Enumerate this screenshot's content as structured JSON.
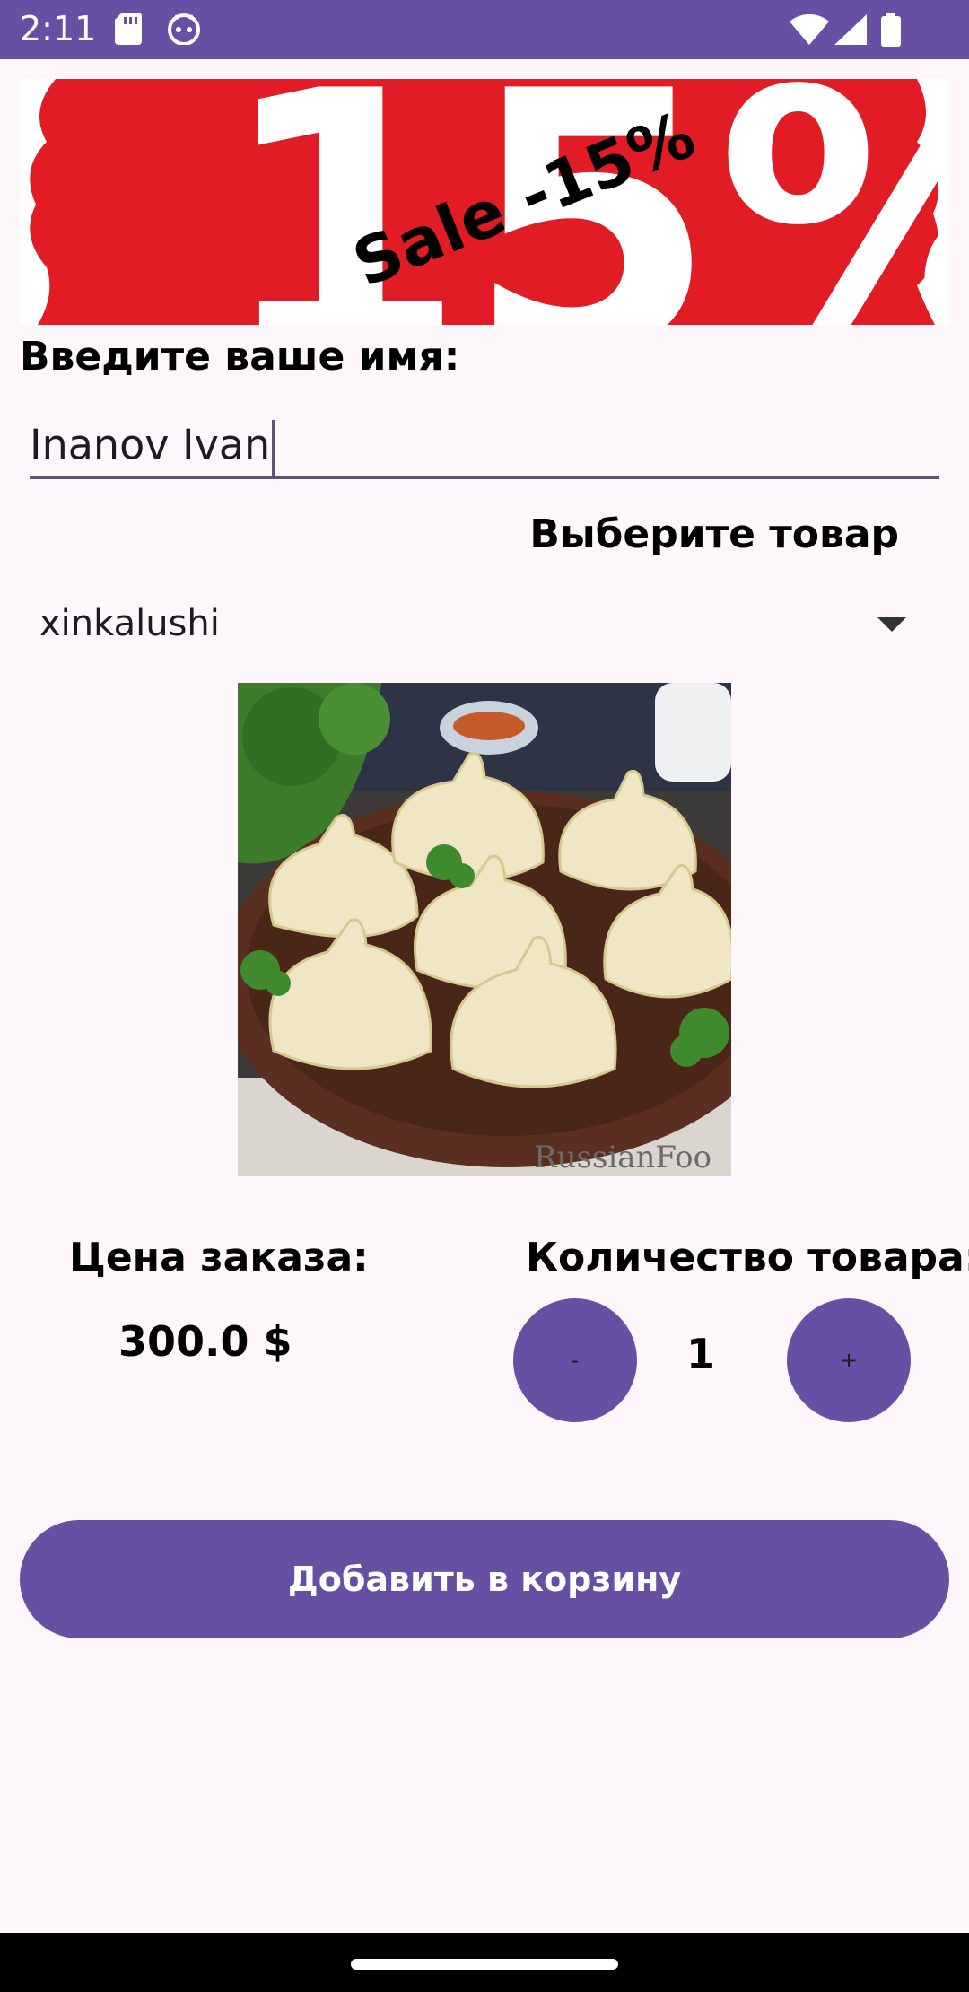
{
  "status_bar": {
    "time": "2:11",
    "icons": [
      "sd-card-icon",
      "cat-face-icon",
      "wifi-icon",
      "signal-icon",
      "battery-icon"
    ]
  },
  "banner": {
    "text": "Sale -15%",
    "background_text": "15%",
    "color": "#e21c24"
  },
  "form": {
    "name_label": "Введите ваше имя:",
    "name_value": "Inanov Ivan",
    "product_label": "Выберите товар",
    "selected_product": "xinkalushi"
  },
  "order": {
    "price_label": "Цена заказа:",
    "price_value": "300.0 $",
    "quantity_label": "Количество товара:",
    "quantity": "1",
    "minus_label": "-",
    "plus_label": "+"
  },
  "add_button_label": "Добавить в корзину",
  "colors": {
    "primary": "#6750a4",
    "background": "#fdf7fb"
  }
}
